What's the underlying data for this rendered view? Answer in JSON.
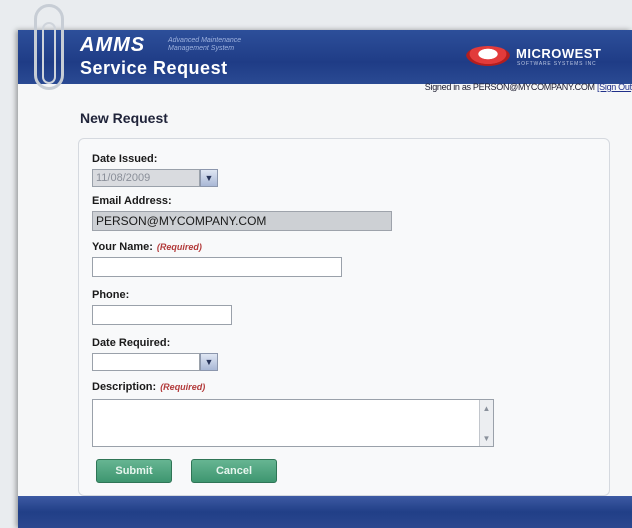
{
  "app": {
    "name": "AMMS",
    "tagline": "Advanced Maintenance Management System",
    "page_title": "Service Request"
  },
  "brand": {
    "logo_text": "MICROWEST",
    "logo_sub": "SOFTWARE SYSTEMS INC"
  },
  "signin": {
    "text": "Signed in as PERSON@MYCOMPANY.COM",
    "signout_label": "[Sign Out]"
  },
  "form": {
    "title": "New Request",
    "required_marker": "(Required)",
    "date_issued": {
      "label": "Date Issued:",
      "value": "11/08/2009"
    },
    "email": {
      "label": "Email Address:",
      "value": "PERSON@MYCOMPANY.COM"
    },
    "your_name": {
      "label": "Your Name:",
      "value": ""
    },
    "phone": {
      "label": "Phone:",
      "value": ""
    },
    "date_required": {
      "label": "Date Required:",
      "value": ""
    },
    "description": {
      "label": "Description:",
      "value": ""
    },
    "submit_label": "Submit",
    "cancel_label": "Cancel"
  },
  "icons": {
    "dropdown": "chevron-down-icon",
    "scroll_up": "arrow-up-icon",
    "scroll_down": "arrow-down-icon",
    "clip": "paperclip-icon"
  },
  "colors": {
    "header": "#1f3c86",
    "button": "#4ea07a",
    "required": "#b23a3a"
  }
}
